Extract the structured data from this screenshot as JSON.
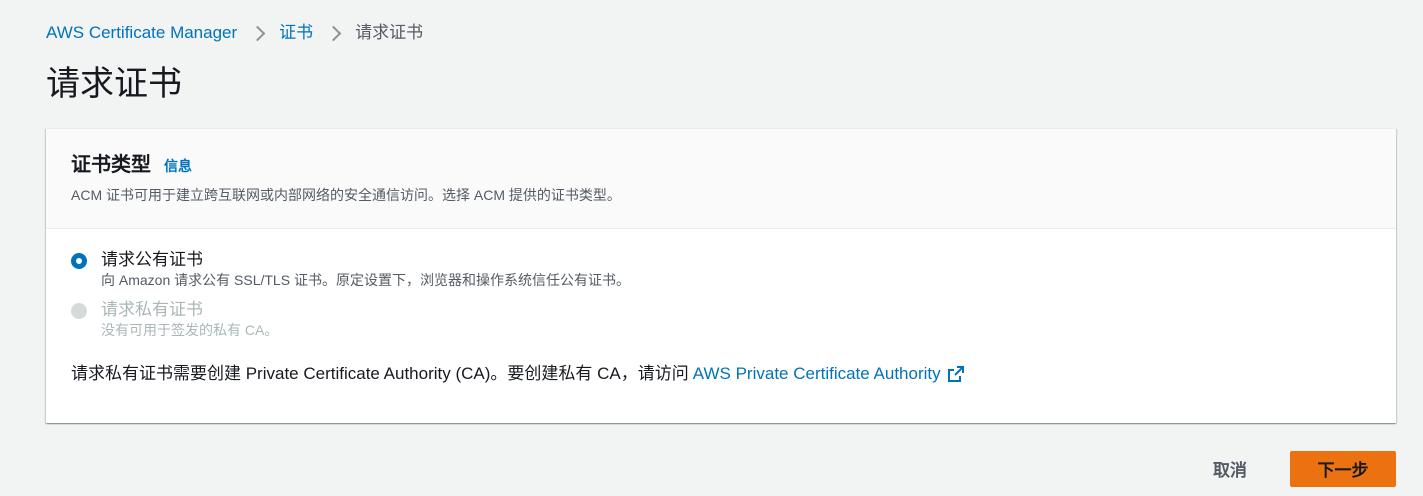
{
  "breadcrumb": {
    "items": [
      {
        "label": "AWS Certificate Manager"
      },
      {
        "label": "证书"
      },
      {
        "label": "请求证书"
      }
    ]
  },
  "page": {
    "title": "请求证书"
  },
  "panel": {
    "title": "证书类型",
    "info_link": "信息",
    "description": "ACM 证书可用于建立跨互联网或内部网络的安全通信访问。选择 ACM 提供的证书类型。",
    "options": [
      {
        "label": "请求公有证书",
        "description": "向 Amazon 请求公有 SSL/TLS 证书。原定设置下，浏览器和操作系统信任公有证书。",
        "selected": true,
        "disabled": false
      },
      {
        "label": "请求私有证书",
        "description": "没有可用于签发的私有 CA。",
        "selected": false,
        "disabled": true
      }
    ],
    "private_note_text": "请求私有证书需要创建 Private Certificate Authority (CA)。要创建私有 CA，请访问",
    "private_note_link": "AWS Private Certificate Authority"
  },
  "actions": {
    "cancel_label": "取消",
    "next_label": "下一步"
  },
  "colors": {
    "accent": "#0073bb",
    "primary_button": "#ec7211",
    "background": "#f2f3f3"
  }
}
